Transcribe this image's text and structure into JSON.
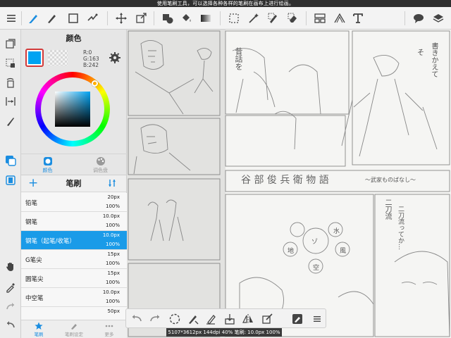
{
  "hint_bar": {
    "text": "使用笔刷工具，可以选择各种各样的笔刷在画布上进行绘画。"
  },
  "toolbar": {
    "icons": [
      "menu-icon",
      "pen-icon",
      "rectangle-icon",
      "symmetry-icon",
      "move-icon",
      "transform-icon",
      "fill-shapes-icon",
      "bucket-icon",
      "gradient-icon",
      "lasso-select-icon",
      "magic-wand-icon",
      "selection-pen-icon",
      "selection-eraser-icon",
      "panel-icon",
      "perspective-icon",
      "text-icon",
      "speech-bubble-icon",
      "material-icon"
    ]
  },
  "left_rail": {
    "icons": [
      "layer-copy-icon",
      "select-layer-icon",
      "rotate-icon",
      "flip-icon",
      "brush-size-icon",
      "color-swap-icon",
      "display-icon",
      "hand-icon",
      "eyedropper-icon",
      "redo-icon",
      "undo-icon"
    ]
  },
  "color_panel": {
    "title": "颜色",
    "r": "R:0",
    "g": "G:163",
    "b": "B:242",
    "tabs": [
      "颜色",
      "调色盘"
    ],
    "current_color": "#00a3f2"
  },
  "brush_panel": {
    "title": "笔刷",
    "brushes": [
      {
        "name": "铅笔",
        "size": "20px",
        "opacity": "100%"
      },
      {
        "name": "钢笔",
        "size": "10.0px",
        "opacity": "100%"
      },
      {
        "name": "钢笔（起笔/收笔）",
        "size": "10.0px",
        "opacity": "100%",
        "selected": true
      },
      {
        "name": "G笔尖",
        "size": "15px",
        "opacity": "100%"
      },
      {
        "name": "圆笔尖",
        "size": "15px",
        "opacity": "100%"
      },
      {
        "name": "中空笔",
        "size": "10.0px",
        "opacity": "100%"
      },
      {
        "name": "",
        "size": "50px",
        "opacity": ""
      }
    ],
    "tabs": [
      "笔刷",
      "笔刷设定",
      "更多"
    ]
  },
  "canvas": {
    "texts": {
      "t1": "昔話を",
      "t2": "書きかえて",
      "t3": "そ",
      "title": "谷 部 俊 兵 衛 物 語",
      "subtitle": "～武家ものばなし～",
      "circle_chars": [
        "ゾ",
        "水",
        "風",
        "空",
        "地"
      ],
      "right1": "二刀流",
      "right2": "二刀流ってか…"
    }
  },
  "bottom_tools": {
    "icons": [
      "undo-icon",
      "redo-icon",
      "deselect-icon",
      "invert-selection-icon",
      "pen-edit-icon",
      "paste-icon",
      "flip-canvas-icon",
      "transform-selection-icon",
      "layer-settings-icon",
      "menu-lines-icon"
    ]
  },
  "status_bar": {
    "text": "5107*3612px 144dpi 40% 笔刷: 10.0px 100%"
  }
}
